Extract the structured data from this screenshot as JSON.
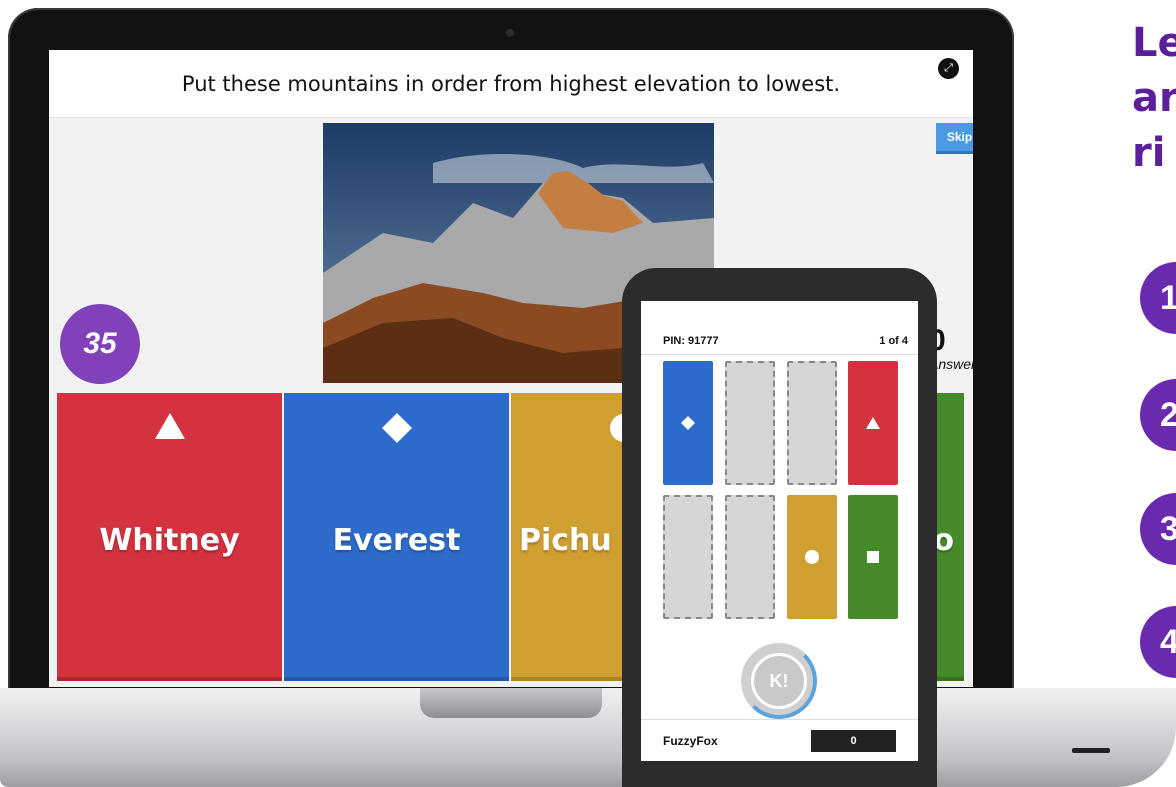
{
  "question": {
    "text": "Put these mountains in order from highest elevation to lowest.",
    "fullscreen_icon": "fullscreen-icon"
  },
  "controls": {
    "skip_label": "Skip"
  },
  "timer": {
    "value": "35"
  },
  "answers_count": {
    "value": "0",
    "label": "Answers"
  },
  "answers": [
    {
      "label": "Whitney",
      "shape": "triangle",
      "color": "#d3323e"
    },
    {
      "label": "Everest",
      "shape": "diamond",
      "color": "#2d6bca"
    },
    {
      "label": "Pichu",
      "shape": "circle",
      "color": "#d09f31"
    },
    {
      "label": "o",
      "shape": "square",
      "color": "#468a2b"
    }
  ],
  "phone": {
    "pin": "PIN: 91777",
    "progress": "1 of 4",
    "k_label": "K!",
    "player": "FuzzyFox",
    "score": "0"
  },
  "promo": {
    "lines": [
      "Le",
      "ar",
      "ri"
    ],
    "steps": [
      "1",
      "2",
      "3",
      "4"
    ]
  }
}
